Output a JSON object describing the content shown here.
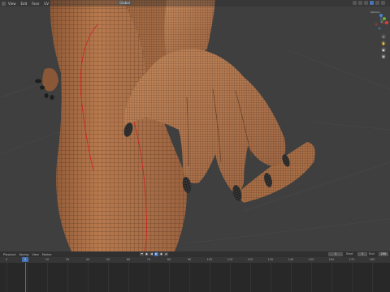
{
  "header": {
    "menus": [
      "View",
      "Edit",
      "Face",
      "UV"
    ],
    "mode": "Global"
  },
  "viewport": {
    "options_label": "Options",
    "gizmo": {
      "x_label": "X",
      "y_label": "Y",
      "z_label": "Z"
    }
  },
  "timeline": {
    "menus": [
      "Playback",
      "Keying",
      "View",
      "Marker"
    ],
    "current_frame": "1",
    "start_label": "Start",
    "start_value": "1",
    "end_label": "End",
    "end_value": "250",
    "indicator": "1",
    "ticks": [
      "0",
      "10",
      "20",
      "30",
      "40",
      "50",
      "60",
      "70",
      "80",
      "90",
      "100",
      "110",
      "120",
      "130",
      "140",
      "150",
      "160",
      "170",
      "180",
      "190"
    ]
  },
  "colors": {
    "skin": "#b87a4e",
    "skin_shadow": "#8f5a37",
    "wire": "#2a1a10",
    "seam": "#d02020",
    "claw": "#1e1e1e",
    "accent": "#4772b3"
  }
}
